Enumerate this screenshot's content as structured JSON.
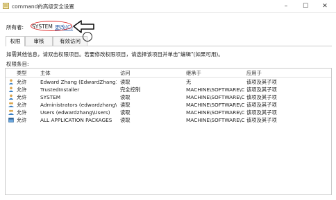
{
  "window": {
    "title": "command的高级安全设置",
    "minimize": "–",
    "maximize": "☐",
    "close": "✕"
  },
  "owner": {
    "label": "所有者:",
    "value": "SYSTEM",
    "change_link": "更改(C)"
  },
  "tabs": [
    {
      "label": "权限",
      "active": true
    },
    {
      "label": "审核",
      "active": false
    },
    {
      "label": "有效访问",
      "active": false
    }
  ],
  "info_text": "如需其他信息，请双击权限项目。若要修改权限项目，请选择该项目并单击\"编辑\"(如果可用)。",
  "entries_label": "权限条目:",
  "columns": [
    "类型",
    "主体",
    "访问",
    "继承于",
    "应用于"
  ],
  "rows": [
    {
      "icon": "user-icon",
      "type": "允许",
      "principal": "Edward Zhang (EdwardZhang12...",
      "access": "读取",
      "inherited": "无",
      "applies": "该项及其子项"
    },
    {
      "icon": "user-icon",
      "type": "允许",
      "principal": "TrustedInstaller",
      "access": "完全控制",
      "inherited": "MACHINE\\SOFTWARE\\Cl...",
      "applies": "该项及其子项"
    },
    {
      "icon": "user-icon",
      "type": "允许",
      "principal": "SYSTEM",
      "access": "读取",
      "inherited": "MACHINE\\SOFTWARE\\Cl...",
      "applies": "该项及其子项"
    },
    {
      "icon": "group-icon",
      "type": "允许",
      "principal": "Administrators (edwardzhang\\A...",
      "access": "读取",
      "inherited": "MACHINE\\SOFTWARE\\Cl...",
      "applies": "该项及其子项"
    },
    {
      "icon": "group-icon",
      "type": "允许",
      "principal": "Users (edwardzhang\\Users)",
      "access": "读取",
      "inherited": "MACHINE\\SOFTWARE\\Cl...",
      "applies": "该项及其子项"
    },
    {
      "icon": "package-icon",
      "type": "允许",
      "principal": "ALL APPLICATION PACKAGES",
      "access": "读取",
      "inherited": "MACHINE\\SOFTWARE\\Cl...",
      "applies": "该项及其子项"
    }
  ],
  "colors": {
    "link": "#2e5fa8",
    "annotation_red": "#dd2222"
  }
}
